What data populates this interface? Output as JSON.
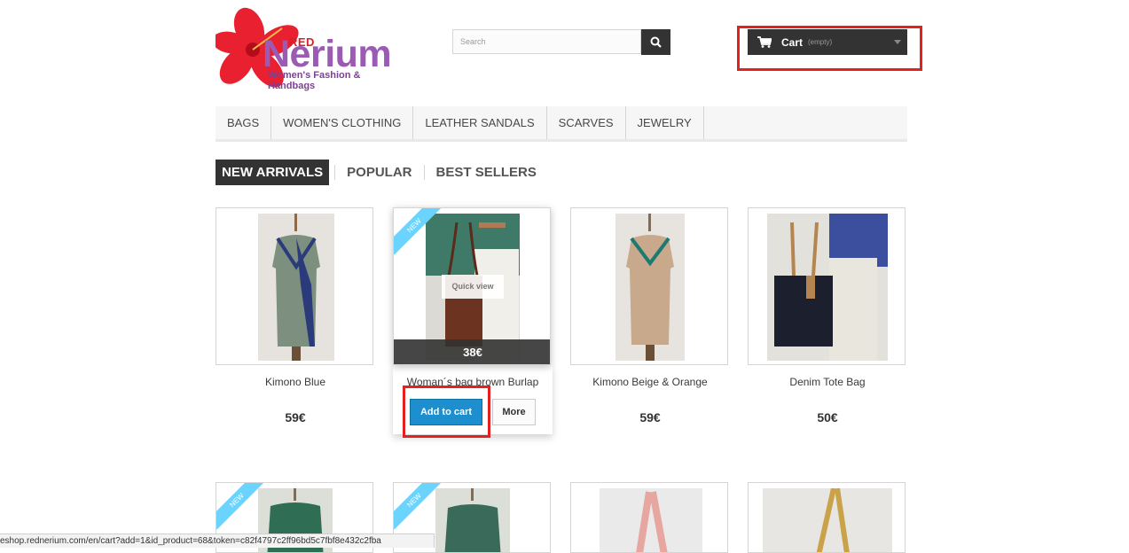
{
  "logo": {
    "brand_small": "RED",
    "brand_name": "Nerium",
    "tagline": "Women's Fashion & Handbags"
  },
  "search": {
    "placeholder": "Search",
    "button_icon": "search-icon"
  },
  "cart": {
    "label": "Cart",
    "status": "(empty)",
    "icon": "cart-icon"
  },
  "menu": {
    "items": [
      {
        "label": "BAGS"
      },
      {
        "label": "WOMEN'S CLOTHING"
      },
      {
        "label": "LEATHER SANDALS"
      },
      {
        "label": "SCARVES"
      },
      {
        "label": "JEWELRY"
      }
    ]
  },
  "tabs": [
    {
      "label": "NEW ARRIVALS",
      "active": true
    },
    {
      "label": "POPULAR"
    },
    {
      "label": "BEST SELLERS"
    }
  ],
  "products": [
    {
      "name": "Kimono Blue",
      "price": "59€"
    },
    {
      "name": "Woman´s bag brown Burlap",
      "price": "38€",
      "badge": "NEW",
      "quick_view": "Quick view",
      "add_to_cart": "Add to cart",
      "more": "More"
    },
    {
      "name": "Kimono Beige & Orange",
      "price": "59€"
    },
    {
      "name": "Denim Tote Bag",
      "price": "50€"
    }
  ],
  "second_row_badges": [
    "NEW",
    "NEW"
  ],
  "statusbar": {
    "url": "eshop.rednerium.com/en/cart?add=1&id_product=68&token=c82f4797c2ff96bd5c7fbf8e432c2fba"
  },
  "colors": {
    "accent_blue": "#1e8fce",
    "highlight_red": "#e32121",
    "ribbon": "#6ad4ff",
    "dark": "#333333"
  }
}
